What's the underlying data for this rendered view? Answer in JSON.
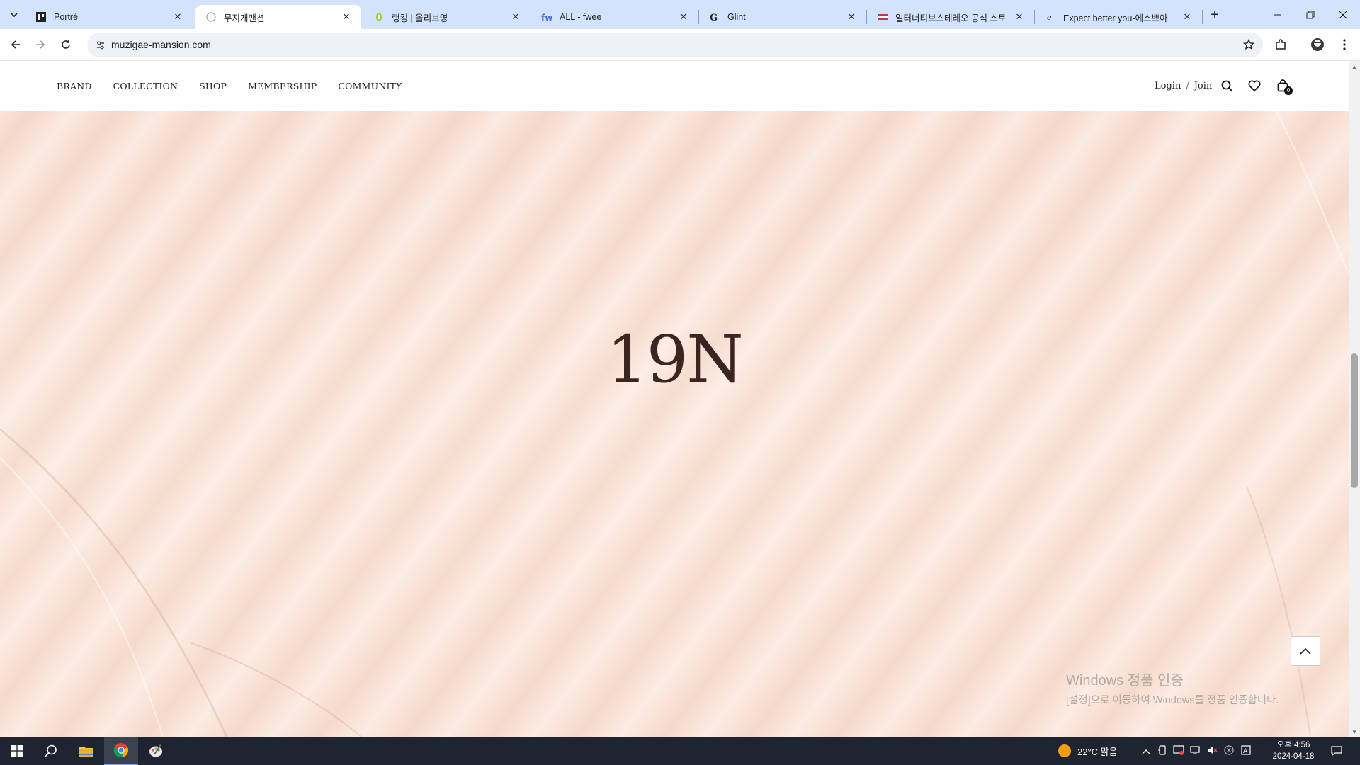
{
  "browser": {
    "tabs": [
      {
        "title": "Portré",
        "active": false
      },
      {
        "title": "무지개맨션",
        "active": true
      },
      {
        "title": "랭킹 | 올리브영",
        "active": false
      },
      {
        "title": "ALL - fwee",
        "active": false
      },
      {
        "title": "Glint",
        "active": false
      },
      {
        "title": "얼터너티브스테레오 공식 스토",
        "active": false
      },
      {
        "title": "Expect better you-에스쁘아",
        "active": false
      }
    ],
    "url": "muzigae-mansion.com"
  },
  "site": {
    "nav": [
      "BRAND",
      "COLLECTION",
      "SHOP",
      "MEMBERSHIP",
      "COMMUNITY"
    ],
    "login": "Login",
    "slash": "/",
    "join": "Join",
    "cart_count": "0",
    "hero_title": "19N"
  },
  "watermark": {
    "line1": "Windows 정품 인증",
    "line2": "[설정]으로 이동하여 Windows를 정품 인증합니다."
  },
  "taskbar": {
    "weather": "22°C 맑음",
    "time": "오후 4:56",
    "date": "2024-04-18"
  },
  "colors": {
    "tabstrip": "#d3e3fd",
    "hero_bg": "#fae4d8",
    "hero_text": "#3c2420",
    "taskbar": "#1f2530"
  }
}
